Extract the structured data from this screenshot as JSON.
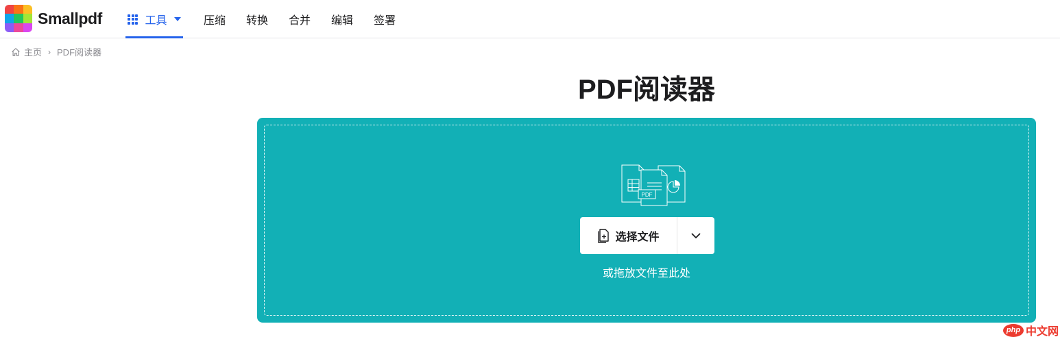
{
  "brand": {
    "name": "Smallpdf",
    "logo_colors": [
      "#ef4444",
      "#f97316",
      "#fbbf24",
      "#0ea5e9",
      "#22c55e",
      "#a3e635",
      "#8b5cf6",
      "#ec4899",
      "#d946ef"
    ]
  },
  "nav": {
    "tools_label": "工具",
    "links": [
      "压缩",
      "转换",
      "合并",
      "编辑",
      "签署"
    ],
    "accent_color": "#2563eb"
  },
  "breadcrumb": {
    "home": "主页",
    "separator": "›",
    "current": "PDF阅读器"
  },
  "page": {
    "title": "PDF阅读器"
  },
  "dropzone": {
    "background_color": "#12b0b6",
    "illustration_badge": "PDF",
    "choose_button_label": "选择文件",
    "hint": "或拖放文件至此处"
  },
  "watermark": {
    "badge": "php",
    "text": "中文网"
  }
}
